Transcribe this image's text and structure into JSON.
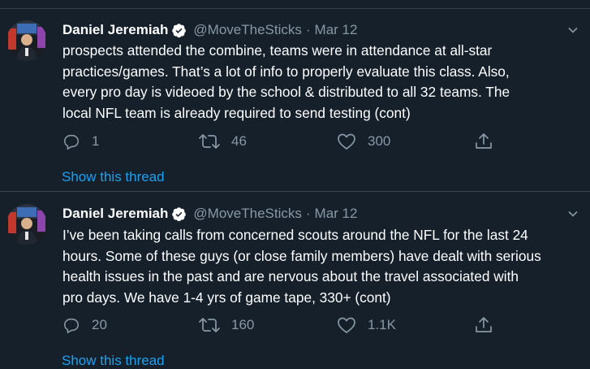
{
  "tweets": [
    {
      "author_name": "Daniel Jeremiah",
      "author_handle": "@MoveTheSticks",
      "separator": "·",
      "date": "Mar 12",
      "text_lines": [
        "prospects attended the combine, teams were in attendance at all-star",
        "practices/games. That’s a lot of info to properly evaluate this class. Also,",
        "every pro day is videoed by the school & distributed to all 32 teams. The",
        "local NFL team is already required to send testing (cont)"
      ],
      "replies": "1",
      "retweets": "46",
      "likes": "300",
      "show_thread": "Show this thread"
    },
    {
      "author_name": "Daniel Jeremiah",
      "author_handle": "@MoveTheSticks",
      "separator": "·",
      "date": "Mar 12",
      "text_lines": [
        "I’ve been taking calls from concerned scouts around the NFL for the last 24",
        "hours. Some of these guys (or close family members) have dealt with serious",
        "health issues in the past and are nervous about the travel associated with",
        "pro days. We have 1-4 yrs of game tape, 330+ (cont)"
      ],
      "replies": "20",
      "retweets": "160",
      "likes": "1.1K",
      "show_thread": "Show this thread"
    }
  ],
  "icons": {
    "verified": "verified-badge-icon",
    "chevron": "chevron-down-icon",
    "reply": "reply-icon",
    "retweet": "retweet-icon",
    "like": "heart-icon",
    "share": "share-icon"
  },
  "colors": {
    "background": "#15202b",
    "text": "#ffffff",
    "muted": "#8899a6",
    "link": "#1da1f2",
    "divider": "#38444d"
  }
}
